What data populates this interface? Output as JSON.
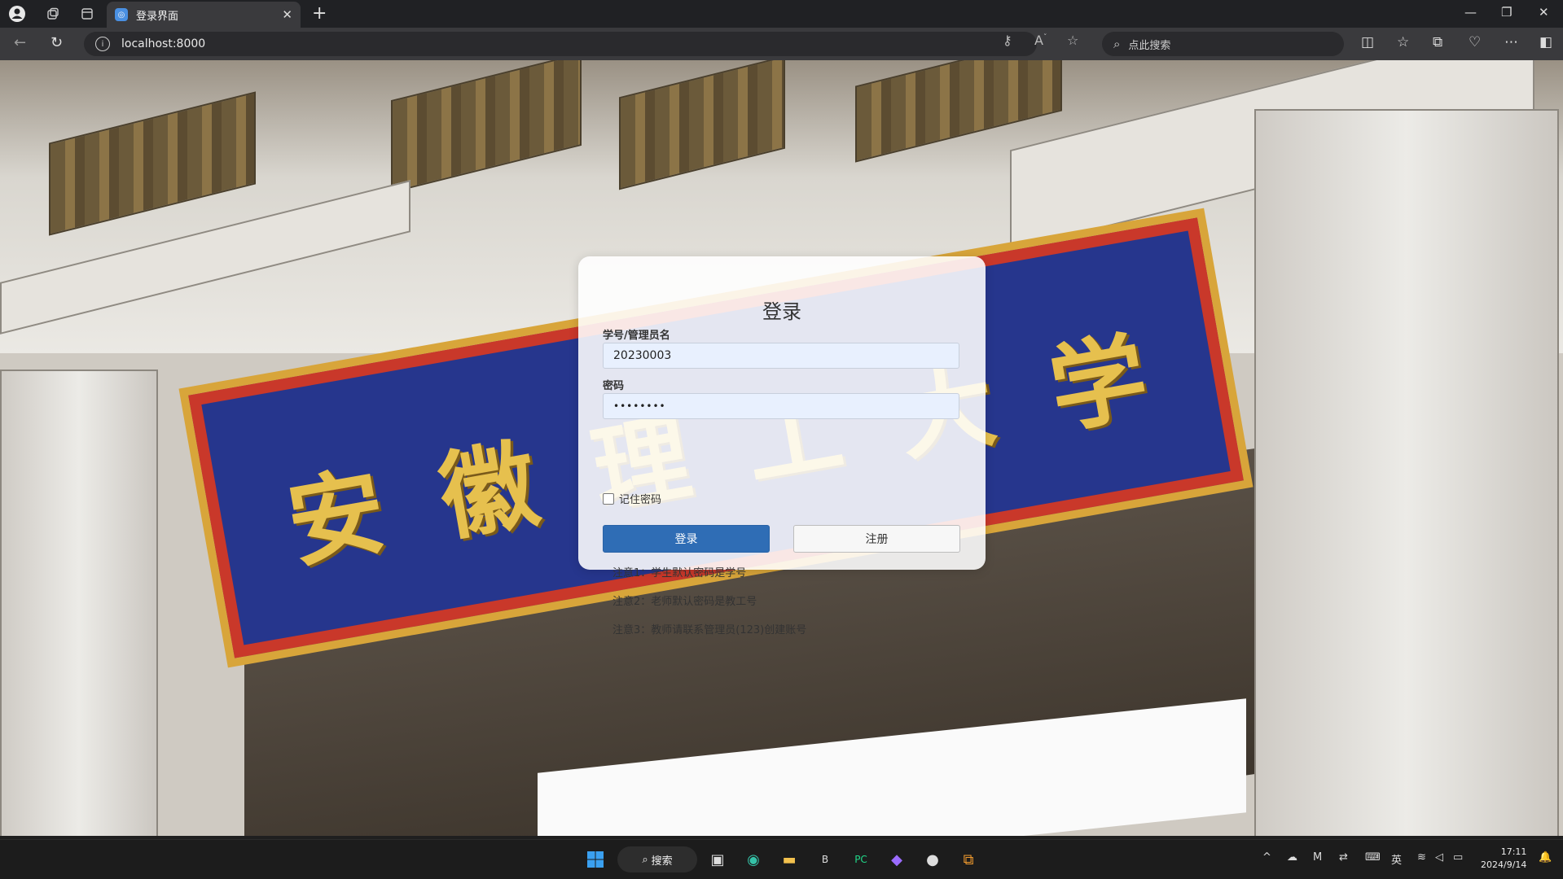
{
  "browser": {
    "tab_title": "登录界面",
    "tab_close": "✕",
    "new_tab": "+",
    "url": "localhost:8000",
    "search_placeholder": "点此搜索"
  },
  "login": {
    "title": "登录",
    "username_label": "学号/管理员名",
    "username_value": "20230003",
    "password_label": "密码",
    "password_value": "••••••••",
    "remember_label": "记住密码",
    "login_button": "登录",
    "register_button": "注册",
    "notes": [
      "注意1：学生默认密码是学号",
      "注意2：老师默认密码是教工号",
      "注意3：教师请联系管理员(123)创建账号"
    ]
  },
  "background": {
    "sign_text": [
      "安",
      "徽",
      "理",
      "工",
      "大",
      "学"
    ],
    "accent_blue": "#26368d",
    "accent_gold": "#d8a53a"
  },
  "taskbar": {
    "search_label": "搜索",
    "ime": "英",
    "time": "17:11",
    "date": "2024/9/14"
  }
}
